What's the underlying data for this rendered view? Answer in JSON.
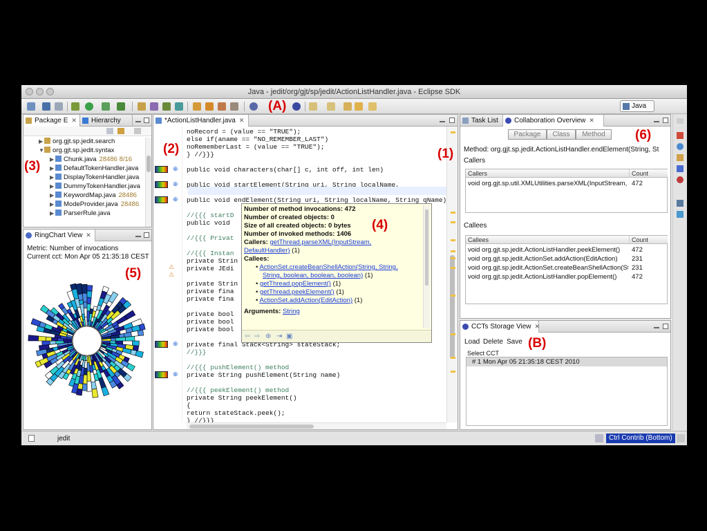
{
  "window": {
    "title": "Java - jedit/org/gjt/sp/jedit/ActionListHandler.java - Eclipse SDK"
  },
  "perspective": {
    "label": "Java"
  },
  "annotations": {
    "A": "(A)",
    "B": "(B)",
    "one": "(1)",
    "two": "(2)",
    "three": "(3)",
    "four": "(4)",
    "five": "(5)",
    "six": "(6)"
  },
  "package_explorer": {
    "tabs": [
      "Package E",
      "Hierarchy"
    ],
    "items": [
      {
        "name": "org.gjt.sp.jedit.search",
        "meta": ""
      },
      {
        "name": "org.gjt.sp.jedit.syntax",
        "meta": ""
      },
      {
        "name": "Chunk.java",
        "meta": "28486  8/16"
      },
      {
        "name": "DefaultTokenHandler.java",
        "meta": ""
      },
      {
        "name": "DisplayTokenHandler.java",
        "meta": ""
      },
      {
        "name": "DummyTokenHandler.java",
        "meta": ""
      },
      {
        "name": "KeywordMap.java",
        "meta": "28486"
      },
      {
        "name": "ModeProvider.java",
        "meta": "28486"
      },
      {
        "name": "ParserRule.java",
        "meta": ""
      }
    ]
  },
  "ringchart": {
    "tab": "RingChart View",
    "metric": "Metric: Number of invocations",
    "current_cct": "Current cct: Mon Apr 05 21:35:18 CEST"
  },
  "editor": {
    "tab": "*ActionListHandler.java",
    "lines": [
      {
        "t": "        noRecord = (value == \"TRUE\");"
      },
      {
        "t": "      else if(aname == \"NO_REMEMBER_LAST\")"
      },
      {
        "t": "        noRememberLast = (value == \"TRUE\");"
      },
      {
        "t": "  } //}}}"
      },
      {
        "t": ""
      },
      {
        "t": "  public void characters(char[] c, int off, int len)"
      },
      {
        "t": ""
      },
      {
        "t": "  public void startElement(String uri, String localName,"
      },
      {
        "t": ""
      },
      {
        "t": "  public void endElement(String uri, String localName, String qName)"
      },
      {
        "t": ""
      },
      {
        "t": "  //{{{ startD"
      },
      {
        "t": "  public void"
      },
      {
        "t": ""
      },
      {
        "t": "  //{{{ Privat"
      },
      {
        "t": ""
      },
      {
        "t": "  //{{{ Instan"
      },
      {
        "t": "  private Strin"
      },
      {
        "t": "  private JEdi"
      },
      {
        "t": ""
      },
      {
        "t": "  private Strin"
      },
      {
        "t": "  private fina"
      },
      {
        "t": "  private fina"
      },
      {
        "t": ""
      },
      {
        "t": "  private bool"
      },
      {
        "t": "  private bool"
      },
      {
        "t": "  private bool"
      },
      {
        "t": ""
      },
      {
        "t": "  private final Stack<String> stateStack;"
      },
      {
        "t": "  //}}}"
      },
      {
        "t": ""
      },
      {
        "t": "  //{{{ pushElement() method"
      },
      {
        "t": "  private String pushElement(String name)"
      },
      {
        "t": ""
      },
      {
        "t": "  //{{{ peekElement() method"
      },
      {
        "t": "  private String peekElement()"
      },
      {
        "t": "  {"
      },
      {
        "t": "    return stateStack.peek();"
      },
      {
        "t": "  } //}}}"
      }
    ]
  },
  "hover": {
    "invocations": "Number of method invocations: 472",
    "created": "Number of created objects: 0",
    "size": "Size of all created objects: 0 bytes",
    "invoked": "Number of invoked methods: 1406",
    "callers_label": "Callers:",
    "caller_link1": "getThread.parseXML(InputStream,",
    "caller_link2": "DefaultHandler)",
    "caller_count": " (1)",
    "callees_label": "Callees:",
    "callees": [
      {
        "link": "ActionSet.createBeanShellAction(String, String,",
        "link2": "String, boolean, boolean, boolean)",
        "count": " (1)"
      },
      {
        "link": "getThread.popElement()",
        "link2": "",
        "count": " (1)"
      },
      {
        "link": "getThread.peekElement()",
        "link2": "",
        "count": " (1)"
      },
      {
        "link": "ActionSet.addAction(EditAction)",
        "link2": "",
        "count": " (1)"
      }
    ],
    "arguments_label": "Arguments:",
    "arguments_link": "String"
  },
  "collab": {
    "tabs": [
      "Task List",
      "Collaboration Overview"
    ],
    "buttons": [
      "Package",
      "Class",
      "Method"
    ],
    "method": "Method: org.gjt.sp.jedit.ActionListHandler.endElement(String, St",
    "callers_title": "Callers",
    "callers_cols": [
      "Callers",
      "Count"
    ],
    "callers_rows": [
      {
        "name": "void org.gjt.sp.util.XMLUtilities.parseXML(InputStream, D",
        "count": "472"
      }
    ],
    "callees_title": "Callees",
    "callees_cols": [
      "Callees",
      "Count"
    ],
    "callees_rows": [
      {
        "name": "void org.gjt.sp.jedit.ActionListHandler.peekElement()",
        "count": "472"
      },
      {
        "name": "void org.gjt.sp.jedit.ActionSet.addAction(EditAction)",
        "count": "231"
      },
      {
        "name": "void org.gjt.sp.jedit.ActionSet.createBeanShellAction(Stri",
        "count": "231"
      },
      {
        "name": "void org.gjt.sp.jedit.ActionListHandler.popElement()",
        "count": "472"
      }
    ]
  },
  "cct": {
    "tab": "CCTs Storage View",
    "load": "Load",
    "delete": "Delete",
    "save": "Save",
    "select_label": "Select CCT",
    "rows": [
      "# 1 Mon Apr 05 21:35:18 CEST 2010"
    ]
  },
  "status": {
    "left": "jedit",
    "right": "Ctrl Contrib (Bottom)"
  },
  "colors": {
    "keyword": "#7f0055",
    "string": "#2a00ff",
    "comment": "#3f7f5f",
    "annotation": "#d80000",
    "highlight": "#1a3bd6"
  }
}
